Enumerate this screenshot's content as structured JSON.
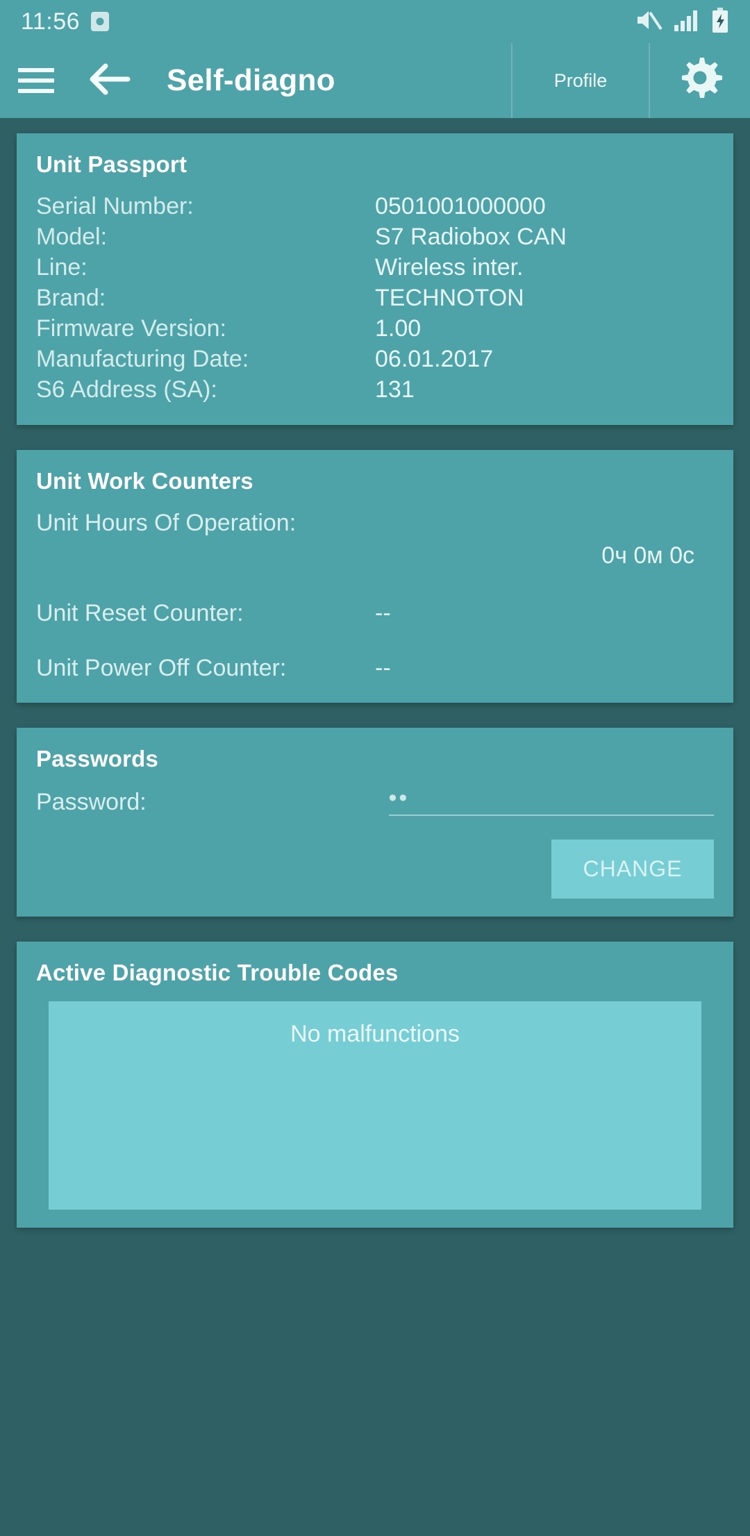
{
  "statusbar": {
    "time": "11:56",
    "clock_icon": "clock-icon",
    "mute_icon": "volume-mute-icon",
    "signal_icon": "signal-bars-icon",
    "battery_icon": "battery-charging-icon"
  },
  "appbar": {
    "menu_icon": "hamburger-menu-icon",
    "back_icon": "arrow-back-icon",
    "title": "Self-diagno",
    "profile_label": "Profile",
    "settings_icon": "gear-icon"
  },
  "passport": {
    "title": "Unit Passport",
    "rows": [
      {
        "key": "Serial Number:",
        "value": "0501001000000"
      },
      {
        "key": "Model:",
        "value": "S7 Radiobox CAN"
      },
      {
        "key": "Line:",
        "value": "Wireless inter."
      },
      {
        "key": "Brand:",
        "value": "TECHNOTON"
      },
      {
        "key": "Firmware Version:",
        "value": "1.00"
      },
      {
        "key": "Manufacturing Date:",
        "value": "06.01.2017"
      },
      {
        "key": "S6 Address (SA):",
        "value": "131"
      }
    ]
  },
  "counters": {
    "title": "Unit Work Counters",
    "hours_label": "Unit Hours Of Operation:",
    "hours_value": "0ч 0м 0с",
    "rows": [
      {
        "key": "Unit Reset Counter:",
        "value": "--"
      },
      {
        "key": "Unit Power Off Counter:",
        "value": "--"
      }
    ]
  },
  "passwords": {
    "title": "Passwords",
    "password_label": "Password:",
    "password_value": "••",
    "password_placeholder": "",
    "change_button": "CHANGE"
  },
  "dtc": {
    "title": "Active Diagnostic Trouble Codes",
    "message": "No malfunctions"
  },
  "colors": {
    "page_bg": "#2f6164",
    "card_bg": "#4ea3a8",
    "accent": "#76cdd3",
    "text_primary": "#ffffff",
    "text_secondary": "#d9eeee"
  }
}
